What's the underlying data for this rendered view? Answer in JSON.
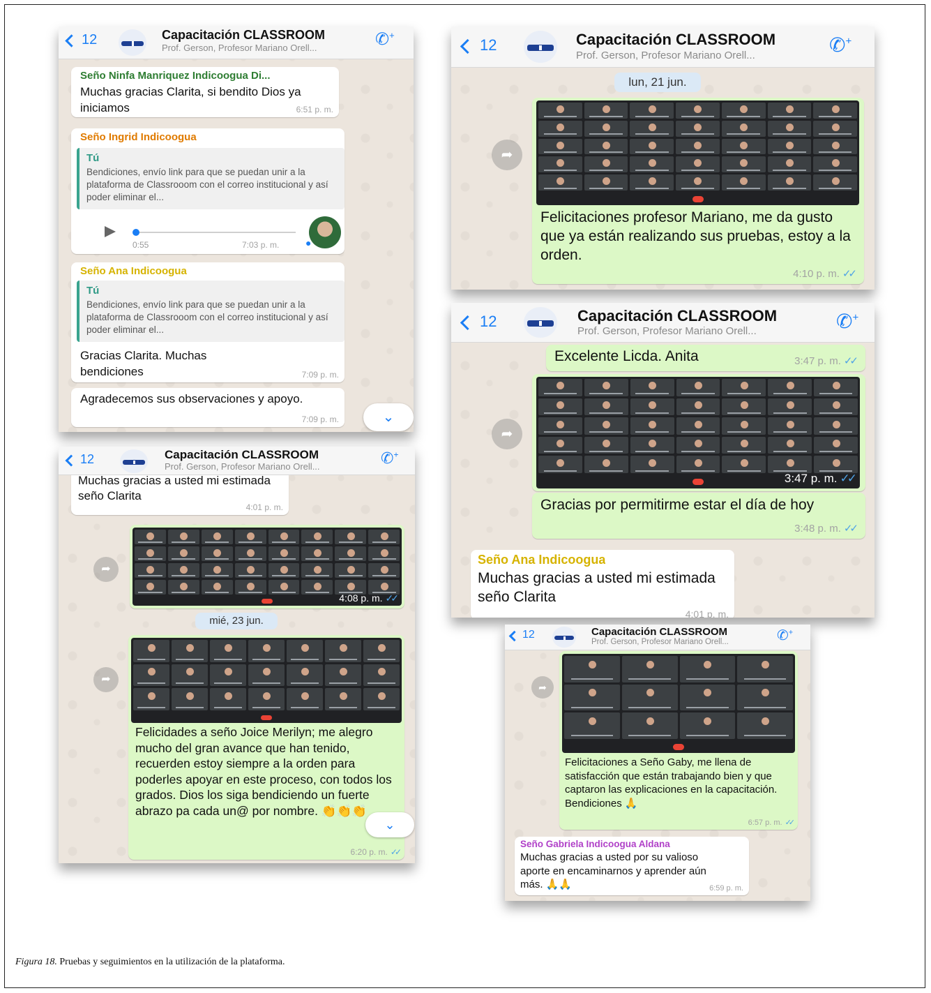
{
  "group": {
    "back_count": "12",
    "name": "Capacitación CLASSROOM",
    "members": "Prof. Gerson, Profesor Mariano Orell..."
  },
  "shot1": {
    "msg1": {
      "sender": "Seño Ninfa Manriquez Indicoogua Di...",
      "text": "Muchas gracias Clarita, si bendito Dios ya iniciamos",
      "time": "6:51 p. m."
    },
    "msg2": {
      "sender": "Seño Ingrid Indicoogua",
      "quote_name": "Tú",
      "quote_text": "Bendiciones, envío link para que se puedan unir a la plataforma de Classrooom con el correo institucional y así poder eliminar el...",
      "duration": "0:55",
      "time": "7:03 p. m."
    },
    "msg3": {
      "sender": "Seño Ana  Indicoogua",
      "quote_name": "Tú",
      "quote_text": "Bendiciones, envío link para que se puedan unir a la plataforma de Classrooom con el correo institucional y así poder eliminar el...",
      "text": "Gracias Clarita. Muchas bendiciones",
      "time": "7:09 p. m."
    },
    "msg4": {
      "text": "Agradecemos sus observaciones y apoyo.",
      "time": "7:09 p. m."
    }
  },
  "shot2": {
    "date": "lun, 21 jun.",
    "msg1": {
      "text": "Felicitaciones profesor Mariano, me da gusto que ya están realizando sus pruebas, estoy a la orden.",
      "time": "4:10 p. m."
    }
  },
  "shot3": {
    "msg1": {
      "text": "Excelente Licda. Anita",
      "time": "3:47 p. m."
    },
    "img_time": "3:47 p. m.",
    "msg2": {
      "text": "Gracias por permitirme estar el día de hoy",
      "time": "3:48 p. m."
    },
    "msg3": {
      "sender": "Seño Ana  Indicoogua",
      "text": "Muchas gracias a usted mi estimada seño Clarita",
      "time": "4:01 p. m."
    }
  },
  "shot4": {
    "msg1": {
      "text": "Muchas gracias a usted mi estimada seño Clarita",
      "time": "4:01 p. m."
    },
    "img_time": "4:08 p. m.",
    "date": "mié, 23 jun.",
    "msg2": {
      "text": "Felicidades a seño Joice Merilyn; me alegro mucho del gran avance que han tenido, recuerden estoy siempre a la orden para poderles apoyar en este proceso, con todos los grados.  Dios los siga bendiciendo un fuerte abrazo pa cada un@ por nombre. 👏👏👏",
      "time": "6:20 p. m."
    }
  },
  "shot5": {
    "msg1": {
      "text": "Felicitaciones a Seño Gaby, me llena de satisfacción que están trabajando bien y que captaron las explicaciones en la capacitación. Bendiciones 🙏",
      "time": "6:57 p. m."
    },
    "msg2": {
      "sender": "Seño Gabriela Indicoogua Aldana",
      "text": "Muchas gracias a usted por su valioso aporte en encaminarnos y aprender aún más. 🙏🙏",
      "time": "6:59 p. m."
    }
  },
  "caption": {
    "label": "Figura 18.",
    "text": " Pruebas y seguimientos en la utilización de la plataforma."
  },
  "colors": {
    "sender_green": "#2e7d32",
    "sender_orange": "#e07b00",
    "sender_yellow": "#d6b300",
    "sender_purple": "#b040c8",
    "link_blue": "#1a7ef5"
  }
}
